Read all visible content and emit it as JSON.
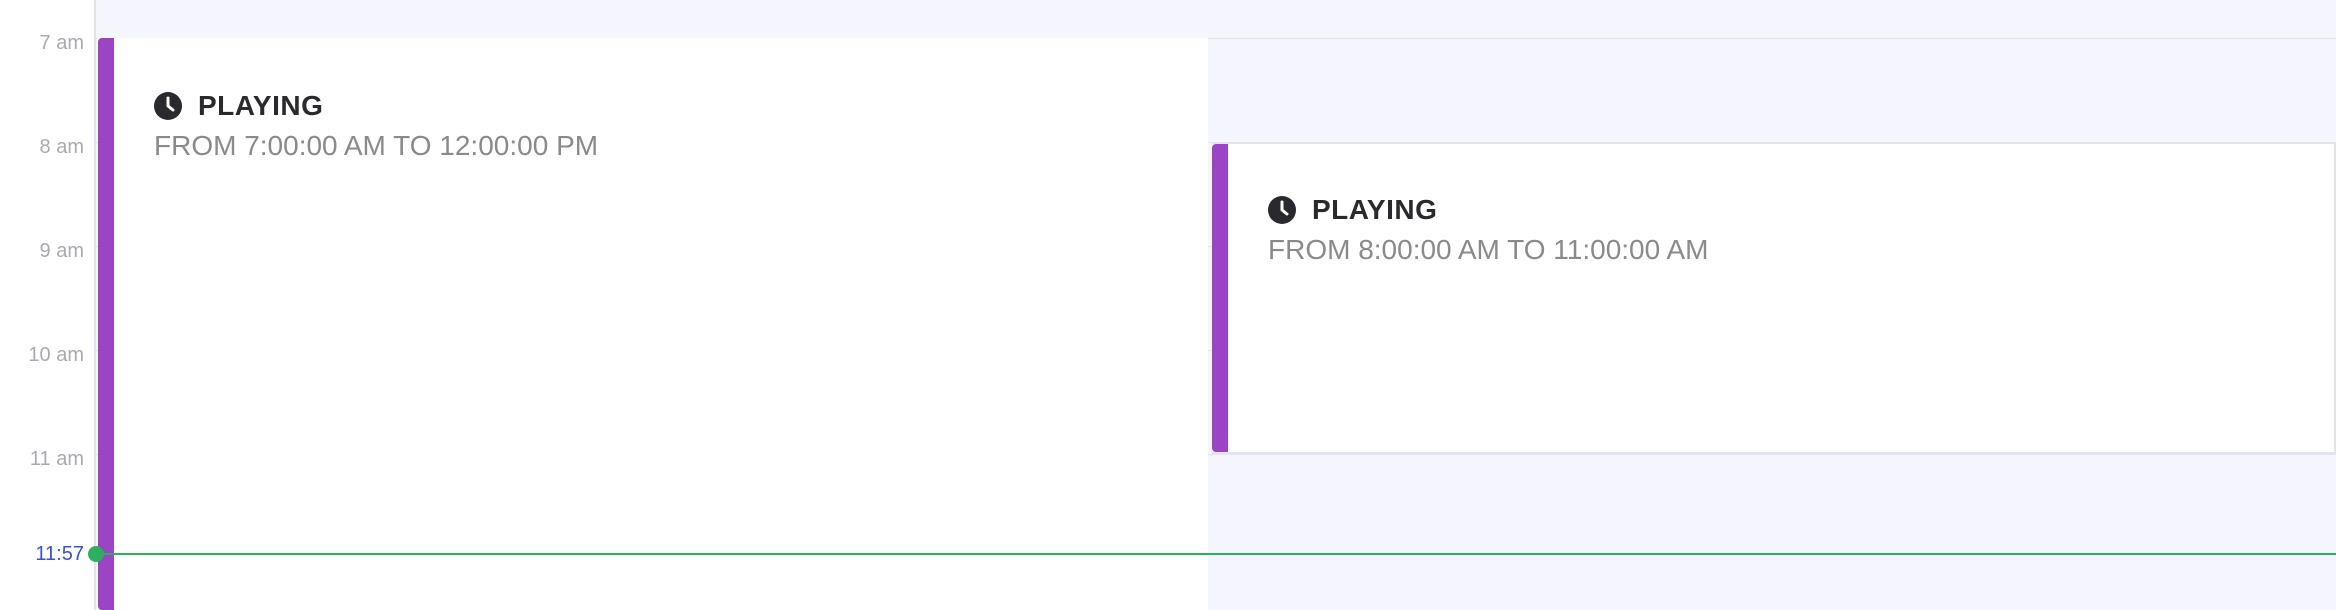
{
  "time_gutter": {
    "hours": [
      "7 am",
      "8 am",
      "9 am",
      "10 am",
      "11 am"
    ],
    "current_time": "11:57"
  },
  "events": [
    {
      "title": "PLAYING",
      "range": "FROM 7:00:00 AM TO 12:00:00 PM",
      "icon": "clock-icon",
      "color": "#9b45c4"
    },
    {
      "title": "PLAYING",
      "range": "FROM 8:00:00 AM TO 11:00:00 AM",
      "icon": "clock-icon",
      "color": "#9b45c4"
    }
  ],
  "colors": {
    "background": "#f5f5fd",
    "event_accent": "#9b45c4",
    "now_indicator": "#2bb15e",
    "now_label": "#3b4fd8"
  }
}
